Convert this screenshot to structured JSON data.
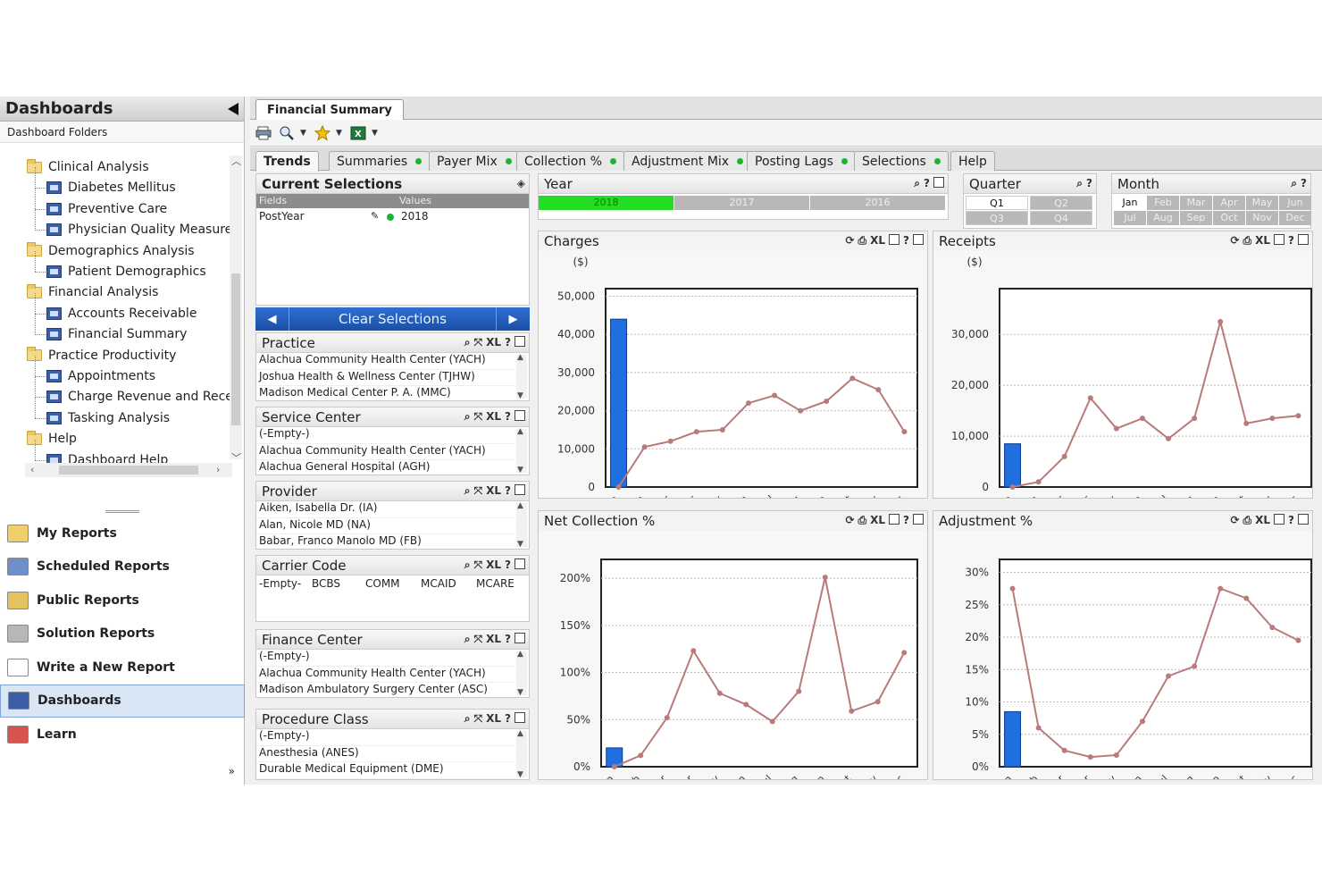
{
  "left_panel": {
    "title": "Dashboards",
    "folders_tab": "Dashboard Folders",
    "tree": [
      {
        "label": "Clinical Analysis",
        "type": "folder"
      },
      {
        "label": "Diabetes Mellitus",
        "type": "dashboard"
      },
      {
        "label": "Preventive Care",
        "type": "dashboard"
      },
      {
        "label": "Physician Quality Measure:",
        "type": "dashboard"
      },
      {
        "label": "Demographics Analysis",
        "type": "folder"
      },
      {
        "label": "Patient Demographics",
        "type": "dashboard"
      },
      {
        "label": "Financial Analysis",
        "type": "folder"
      },
      {
        "label": "Accounts Receivable",
        "type": "dashboard"
      },
      {
        "label": "Financial Summary",
        "type": "dashboard"
      },
      {
        "label": "Practice Productivity",
        "type": "folder"
      },
      {
        "label": "Appointments",
        "type": "dashboard"
      },
      {
        "label": "Charge Revenue and Rece",
        "type": "dashboard"
      },
      {
        "label": "Tasking Analysis",
        "type": "dashboard"
      },
      {
        "label": "Help",
        "type": "folder"
      },
      {
        "label": "Dashboard Help",
        "type": "dashboard"
      }
    ],
    "nav": [
      {
        "label": "My Reports",
        "icon": "folder-icon",
        "color": "#f0cf6b"
      },
      {
        "label": "Scheduled Reports",
        "icon": "calendar-clock-icon",
        "color": "#6f8fc9"
      },
      {
        "label": "Public Reports",
        "icon": "public-folder-icon",
        "color": "#e3c35e"
      },
      {
        "label": "Solution Reports",
        "icon": "solution-icon",
        "color": "#b7b7b7"
      },
      {
        "label": "Write a New Report",
        "icon": "new-document-icon",
        "color": "#ffffff"
      },
      {
        "label": "Dashboards",
        "icon": "dashboard-icon",
        "color": "#3a5fa8",
        "active": true
      },
      {
        "label": "Learn",
        "icon": "learn-icon",
        "color": "#d9534f"
      }
    ],
    "more": "»"
  },
  "doc_tab": "Financial Summary",
  "toolbar": {
    "icons": [
      "print-icon",
      "search-icon",
      "favorites-icon",
      "excel-icon"
    ]
  },
  "sheet_tabs": [
    {
      "label": "Trends",
      "active": true,
      "dot": false
    },
    {
      "label": "Summaries",
      "dot": true
    },
    {
      "label": "Payer Mix",
      "dot": true
    },
    {
      "label": "Collection %",
      "dot": true
    },
    {
      "label": "Adjustment Mix",
      "dot": true
    },
    {
      "label": "Posting Lags",
      "dot": true
    },
    {
      "label": "Selections",
      "dot": true
    },
    {
      "label": "Help",
      "dot": false
    }
  ],
  "current_selections": {
    "title": "Current Selections",
    "col_fields": "Fields",
    "col_values": "Values",
    "rows": [
      {
        "field": "PostYear",
        "value": "2018"
      }
    ],
    "clear_label": "Clear Selections"
  },
  "listboxes": [
    {
      "title": "Practice",
      "items": [
        "Alachua Community Health Center (YACH)",
        "Joshua Health & Wellness Center (TJHW)",
        "Madison Medical Center P. A. (MMC)"
      ]
    },
    {
      "title": "Service Center",
      "items": [
        "(-Empty-)",
        "Alachua Community Health Center (YACH)",
        "Alachua General Hospital (AGH)"
      ]
    },
    {
      "title": "Provider",
      "items": [
        "Aiken, Isabella Dr. (IA)",
        "Alan, Nicole MD (NA)",
        "Babar, Franco Manolo MD (FB)"
      ]
    },
    {
      "title": "Carrier Code",
      "items": [
        "-Empty-",
        "BCBS",
        "COMM",
        "MCAID",
        "MCARE"
      ]
    },
    {
      "title": "Finance Center",
      "items": [
        "(-Empty-)",
        "Alachua Community Health Center (YACH)",
        "Madison Ambulatory Surgery Center (ASC)"
      ]
    },
    {
      "title": "Procedure Class",
      "items": [
        "(-Empty-)",
        "Anesthesia (ANES)",
        "Durable Medical Equipment (DME)"
      ]
    }
  ],
  "year": {
    "title": "Year",
    "options": [
      "2018",
      "2017",
      "2016"
    ],
    "selected": "2018"
  },
  "quarter": {
    "title": "Quarter",
    "options": [
      "Q1",
      "Q2",
      "Q3",
      "Q4"
    ]
  },
  "month": {
    "title": "Month",
    "options": [
      "Jan",
      "Feb",
      "Mar",
      "Apr",
      "May",
      "Jun",
      "Jul",
      "Aug",
      "Sep",
      "Oct",
      "Nov",
      "Dec"
    ]
  },
  "colors": {
    "bar": "#1f6fe0",
    "line": "#b97a7a",
    "selected": "#22dd22",
    "alt": "#b8b8b8"
  },
  "chart_data": [
    {
      "type": "bar",
      "title": "Charges",
      "ylabel": "($)",
      "categories": [
        "Jan",
        "Feb",
        "Mar",
        "Apr",
        "May",
        "Jun",
        "Jul",
        "Aug",
        "Sep",
        "Oct",
        "Nov",
        "Dec"
      ],
      "yticks": [
        "0",
        "10,000",
        "20,000",
        "30,000",
        "40,000",
        "50,000"
      ],
      "ylim": [
        0,
        52000
      ],
      "bar": {
        "category": "Jan",
        "value": 44000
      },
      "line": [
        0,
        10500,
        12000,
        14500,
        15000,
        22000,
        24000,
        20000,
        22500,
        28500,
        25500,
        14500
      ]
    },
    {
      "type": "bar",
      "title": "Receipts",
      "ylabel": "($)",
      "categories": [
        "Jan",
        "Feb",
        "Mar",
        "Apr",
        "May",
        "Jun",
        "Jul",
        "Aug",
        "Sep",
        "Oct",
        "Nov",
        "Dec"
      ],
      "yticks": [
        "0",
        "10,000",
        "20,000",
        "30,000"
      ],
      "ylim": [
        0,
        39000
      ],
      "bar": {
        "category": "Jan",
        "value": 8500
      },
      "line": [
        0,
        1000,
        6000,
        17500,
        11500,
        13500,
        9500,
        13500,
        32500,
        12500,
        13500,
        14000
      ]
    },
    {
      "type": "bar",
      "title": "Net Collection %",
      "ylabel": "",
      "categories": [
        "Jan",
        "Feb",
        "Mar",
        "Apr",
        "May",
        "Jun",
        "Jul",
        "Aug",
        "Sep",
        "Oct",
        "Nov",
        "Dec"
      ],
      "yticks": [
        "0%",
        "50%",
        "100%",
        "150%",
        "200%"
      ],
      "ylim": [
        0,
        220
      ],
      "bar": {
        "category": "Jan",
        "value": 20
      },
      "line": [
        0,
        12,
        52,
        123,
        78,
        66,
        48,
        80,
        201,
        59,
        69,
        121
      ]
    },
    {
      "type": "bar",
      "title": "Adjustment %",
      "ylabel": "",
      "categories": [
        "Jan",
        "Feb",
        "Mar",
        "Apr",
        "May",
        "Jun",
        "Jul",
        "Aug",
        "Sep",
        "Oct",
        "Nov",
        "Dec"
      ],
      "yticks": [
        "0%",
        "5%",
        "10%",
        "15%",
        "20%",
        "25%",
        "30%"
      ],
      "ylim": [
        0,
        32
      ],
      "bar": {
        "category": "Jan",
        "value": 8.5
      },
      "line": [
        27.5,
        6,
        2.5,
        1.5,
        1.8,
        7,
        14,
        15.5,
        27.5,
        26,
        21.5,
        19.5
      ]
    }
  ]
}
